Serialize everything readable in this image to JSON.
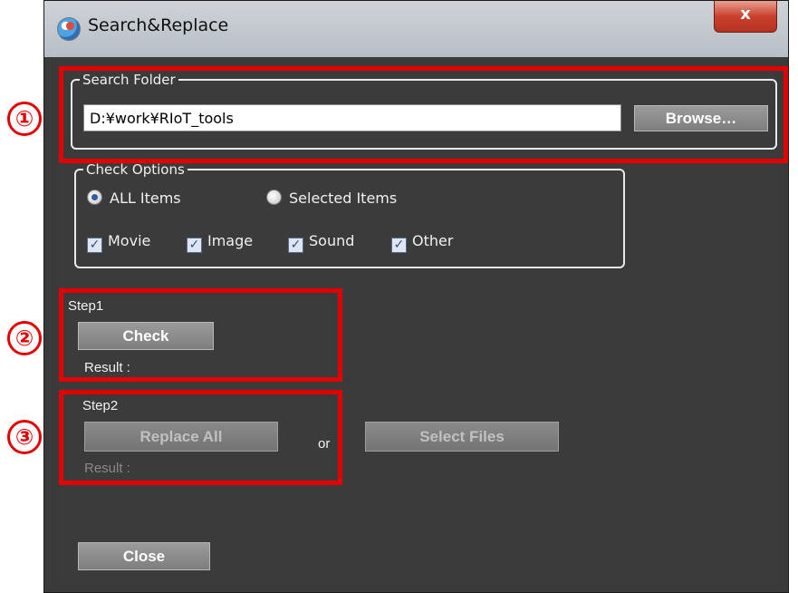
{
  "window": {
    "title": "Search&Replace",
    "close_glyph": "x"
  },
  "search_folder": {
    "legend": "Search Folder",
    "path_value": "D:¥work¥RIoT_tools",
    "browse_label": "Browse…"
  },
  "check_options": {
    "legend": "Check Options",
    "radios": [
      {
        "label": "ALL Items",
        "selected": true
      },
      {
        "label": "Selected Items",
        "selected": false
      }
    ],
    "types": [
      {
        "label": "Movie",
        "checked": true
      },
      {
        "label": "Image",
        "checked": true
      },
      {
        "label": "Sound",
        "checked": true
      },
      {
        "label": "Other",
        "checked": true
      }
    ]
  },
  "step1": {
    "title": "Step1",
    "check_label": "Check",
    "result_label": "Result :"
  },
  "step2": {
    "title": "Step2",
    "replace_all_label": "Replace All",
    "or_label": "or",
    "select_files_label": "Select Files",
    "result_label": "Result :"
  },
  "footer": {
    "close_label": "Close"
  },
  "annotations": {
    "markers": [
      "①",
      "②",
      "③"
    ],
    "color": "#e30000"
  },
  "icons": {
    "app": "globe-icon",
    "check": "✓"
  }
}
